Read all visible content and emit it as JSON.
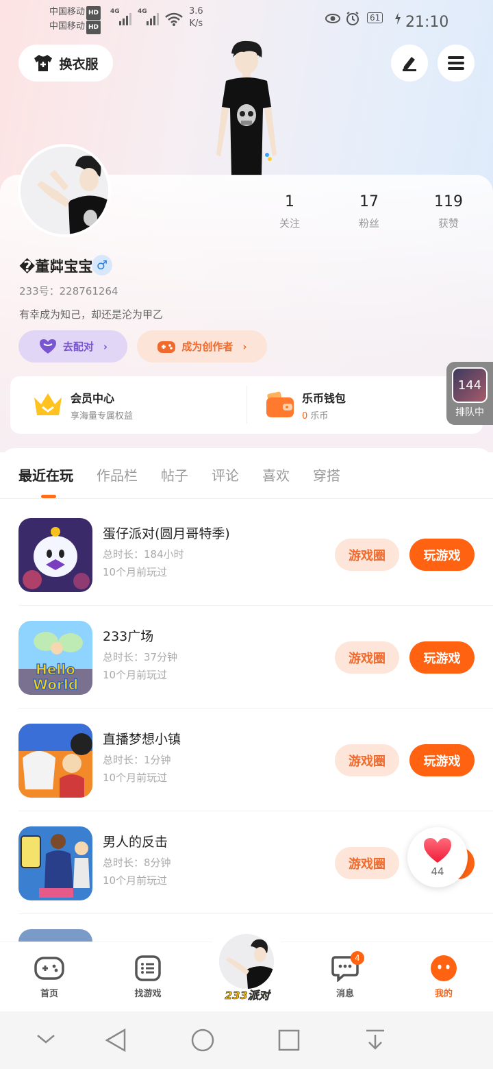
{
  "status_bar": {
    "carrier1": "中国移动",
    "carrier2": "中国移动",
    "hd": "HD",
    "net1": "4G",
    "net2": "4G",
    "speed_value": "3.6",
    "speed_unit": "K/s",
    "battery": "61",
    "time": "21:10"
  },
  "header": {
    "outfit_label": "换衣服",
    "edit_icon": "pencil-icon",
    "menu_icon": "hamburger-menu-icon"
  },
  "profile": {
    "stats": [
      {
        "num": "1",
        "label": "关注"
      },
      {
        "num": "17",
        "label": "粉丝"
      },
      {
        "num": "119",
        "label": "获赞"
      }
    ],
    "username": "�董茻宝宝.",
    "gender": "♂",
    "uid_label": "233号：",
    "uid": "228761264",
    "bio": "有幸成为知己，却还是沦为甲乙",
    "match_label": "去配对",
    "creator_label": "成为创作者"
  },
  "benefits": {
    "vip_title": "会员中心",
    "vip_sub": "享海量专属权益",
    "wallet_title": "乐币钱包",
    "wallet_amount": "0",
    "wallet_unit": "乐币"
  },
  "queue": {
    "count": "144",
    "label": "排队中"
  },
  "tabs": [
    "最近在玩",
    "作品栏",
    "帖子",
    "评论",
    "喜欢",
    "穿搭"
  ],
  "games": [
    {
      "name": "蛋仔派对(圆月哥特季)",
      "duration": "总时长：184小时",
      "last": "10个月前玩过"
    },
    {
      "name": "233广场",
      "duration": "总时长：37分钟",
      "last": "10个月前玩过"
    },
    {
      "name": "直播梦想小镇",
      "duration": "总时长：1分钟",
      "last": "10个月前玩过"
    },
    {
      "name": "男人的反击",
      "duration": "总时长：8分钟",
      "last": "10个月前玩过"
    }
  ],
  "game_buttons": {
    "circle": "游戏圈",
    "play": "玩游戏"
  },
  "game_icon_text": {
    "hello": "Hello",
    "world": "World"
  },
  "like": {
    "count": "44"
  },
  "bottom_nav": {
    "home": "首页",
    "find": "找游戏",
    "center": "233派对",
    "messages": "消息",
    "messages_badge": "4",
    "me": "我的"
  },
  "colors": {
    "accent": "#ff6312",
    "accent_light": "#fde6d9",
    "purple": "#7a55d2"
  }
}
